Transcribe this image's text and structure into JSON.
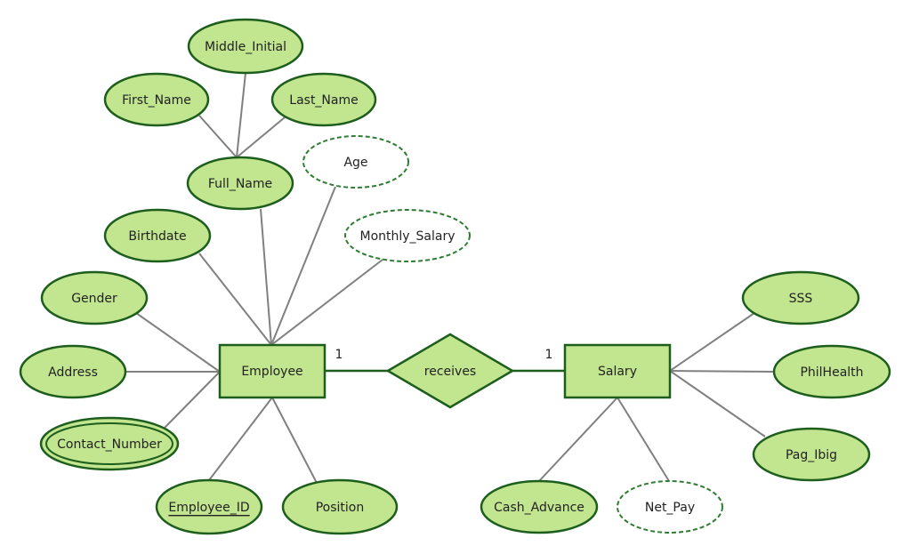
{
  "colors": {
    "entity_fill": "#c2e590",
    "border": "#1d5e1d",
    "connector": "#808080"
  },
  "entities": {
    "employee": "Employee",
    "salary": "Salary"
  },
  "relationship": {
    "label": "receives",
    "cardinality_left": "1",
    "cardinality_right": "1"
  },
  "employee_attributes": {
    "middle_initial": "Middle_Initial",
    "first_name": "First_Name",
    "last_name": "Last_Name",
    "full_name": "Full_Name",
    "age": "Age",
    "birthdate": "Birthdate",
    "monthly_salary": "Monthly_Salary",
    "gender": "Gender",
    "address": "Address",
    "contact_number": "Contact_Number",
    "employee_id": "Employee_ID",
    "position": "Position"
  },
  "salary_attributes": {
    "sss": "SSS",
    "philhealth": "PhilHealth",
    "pag_ibig": "Pag_Ibig",
    "cash_advance": "Cash_Advance",
    "net_pay": "Net_Pay"
  }
}
